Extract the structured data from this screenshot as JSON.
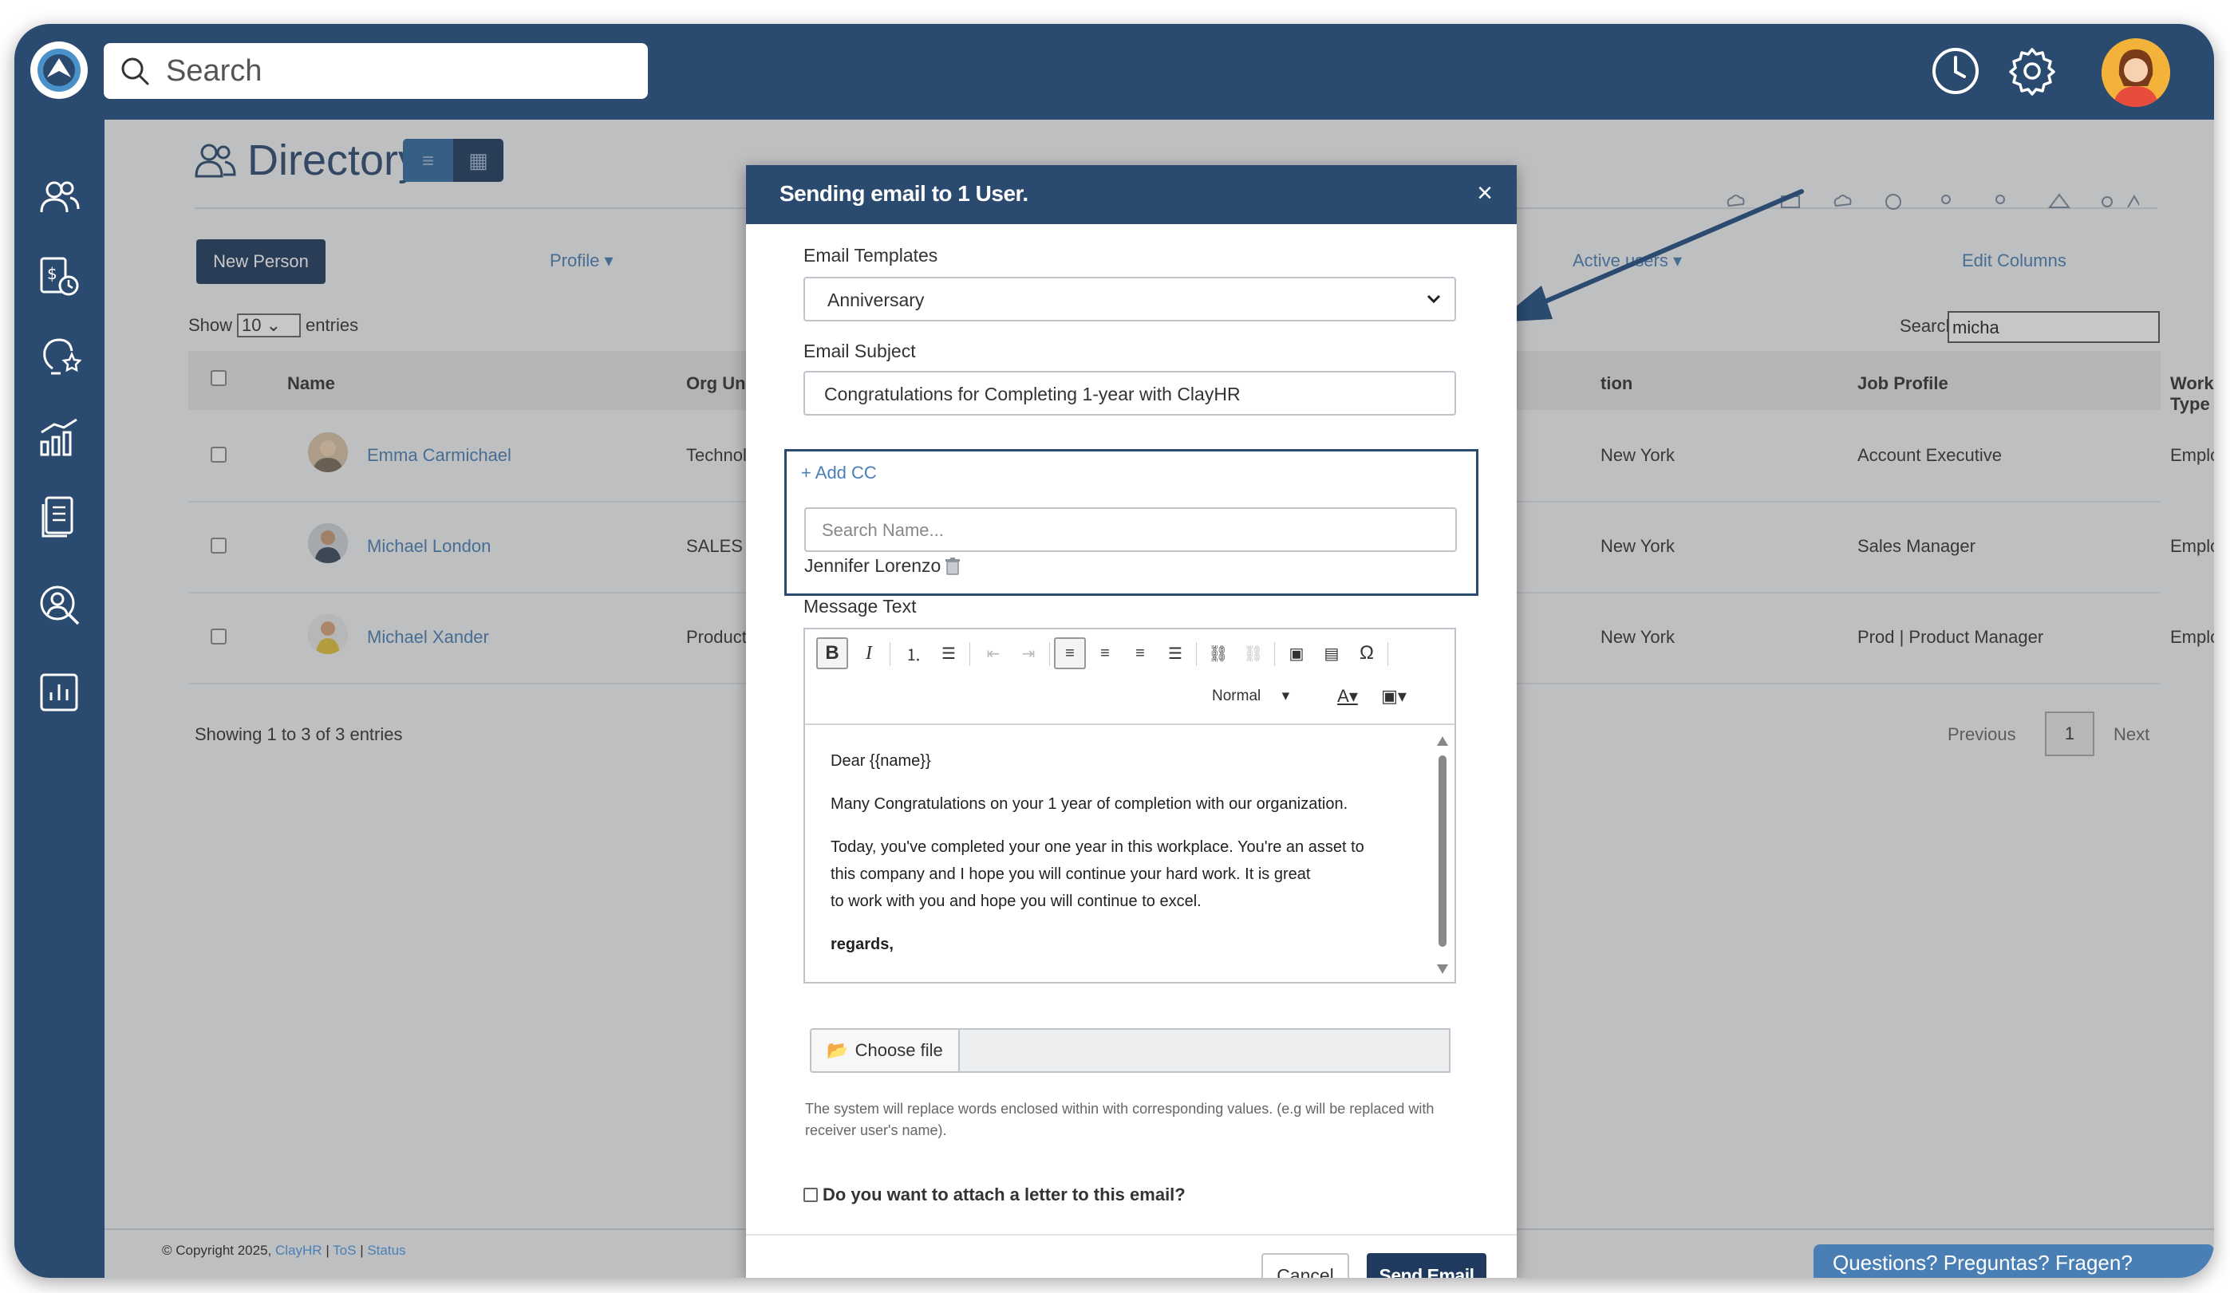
{
  "topbar": {
    "search_placeholder": "Search"
  },
  "directory": {
    "title": "Directory",
    "new_person_label": "New Person",
    "filters": {
      "profile": "Profile",
      "active_users": "Active users",
      "edit_columns": "Edit Columns"
    },
    "show_label": "Show",
    "show_value": "10",
    "entries_label": "entries",
    "search_label": "Search:",
    "search_value": "micha",
    "columns": [
      "Name",
      "Org Unit",
      "tion",
      "Job Profile",
      "Worker Type"
    ],
    "rows": [
      {
        "name": "Emma Carmichael",
        "org": "Technology",
        "location": "New York",
        "job": "Account Executive",
        "worker": "Employee"
      },
      {
        "name": "Michael London",
        "org": "SALES | Retai",
        "location": "New York",
        "job": "Sales Manager",
        "worker": "Employee"
      },
      {
        "name": "Michael Xander",
        "org": "Product Man",
        "location": "New York",
        "job": "Prod | Product Manager",
        "worker": "Employee"
      }
    ],
    "showing": "Showing 1 to 3 of 3 entries",
    "pager": {
      "previous": "Previous",
      "page": "1",
      "next": "Next"
    }
  },
  "footer": {
    "copyright": "© Copyright 2025,",
    "brand": "ClayHR",
    "sep": "|",
    "tos": "ToS",
    "status": "Status"
  },
  "help_widget": "Questions? Preguntas? Fragen?",
  "modal": {
    "title": "Sending email to 1 User.",
    "close": "×",
    "template_label": "Email Templates",
    "template_value": "Anniversary",
    "subject_label": "Email Subject",
    "subject_value": "Congratulations for Completing 1-year with ClayHR",
    "add_cc": "Add CC",
    "cc_search_placeholder": "Search Name...",
    "cc_person": "Jennifer Lorenzo",
    "message_label": "Message Text",
    "format_value": "Normal",
    "body": {
      "greeting": "Dear {{name}}",
      "line1": "Many Congratulations on your 1 year of completion with our organization.",
      "line2a": "Today, you've completed your one year in this workplace. You're an asset to",
      "line2b": "this company and I hope you will continue your hard work. It is great",
      "line2c": "to work with you and hope you will continue to excel.",
      "closing": "regards,"
    },
    "choose_file": "Choose file",
    "hint": "The system will replace words enclosed within with corresponding values. (e.g will be replaced with receiver user's name).",
    "attach_label": "Do you want to attach a letter to this email?",
    "cancel": "Cancel",
    "send": "Send Email"
  }
}
